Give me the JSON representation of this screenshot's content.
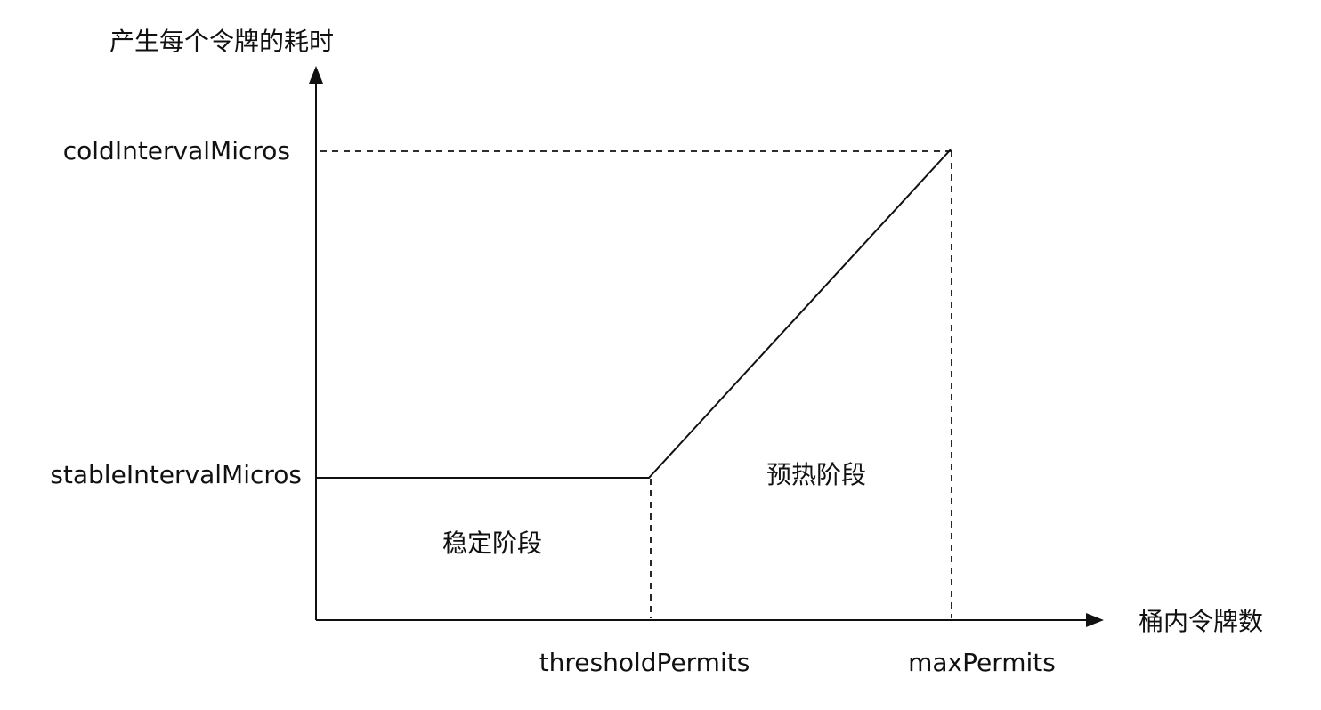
{
  "y_axis_title": "产生每个令牌的耗时",
  "x_axis_title": "桶内令牌数",
  "y_ticks": {
    "cold": "coldIntervalMicros",
    "stable": "stableIntervalMicros"
  },
  "x_ticks": {
    "threshold": "thresholdPermits",
    "max": "maxPermits"
  },
  "regions": {
    "stable": "稳定阶段",
    "warmup": "预热阶段"
  }
}
